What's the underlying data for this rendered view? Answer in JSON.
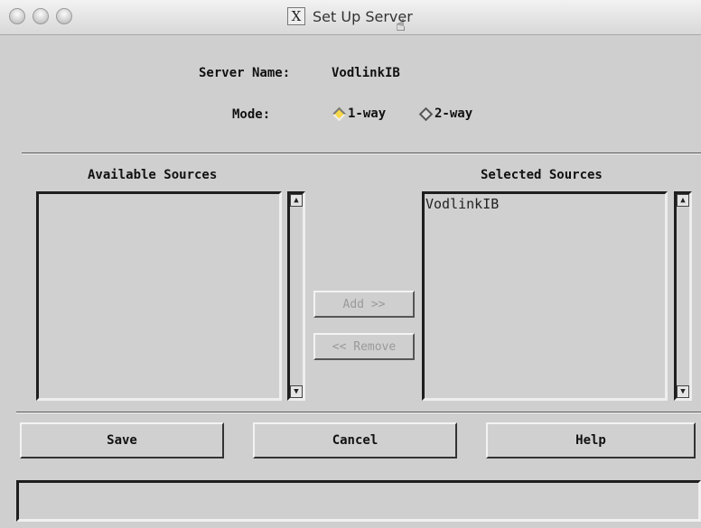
{
  "window": {
    "title": "Set Up Server",
    "x_logo": "X"
  },
  "server": {
    "name_label": "Server Name:",
    "name_value": "VodlinkIB"
  },
  "mode": {
    "label": "Mode:",
    "options": [
      {
        "label": "1-way",
        "selected": true
      },
      {
        "label": "2-way",
        "selected": false
      }
    ]
  },
  "available": {
    "header": "Available Sources",
    "items": []
  },
  "selected": {
    "header": "Selected Sources",
    "items": [
      "VodlinkIB"
    ]
  },
  "transfer": {
    "add_label": "Add >>",
    "remove_label": "<< Remove"
  },
  "actions": {
    "save": "Save",
    "cancel": "Cancel",
    "help": "Help"
  },
  "colors": {
    "accent_radio": "#f8d84a",
    "background": "#cfcfcf"
  }
}
